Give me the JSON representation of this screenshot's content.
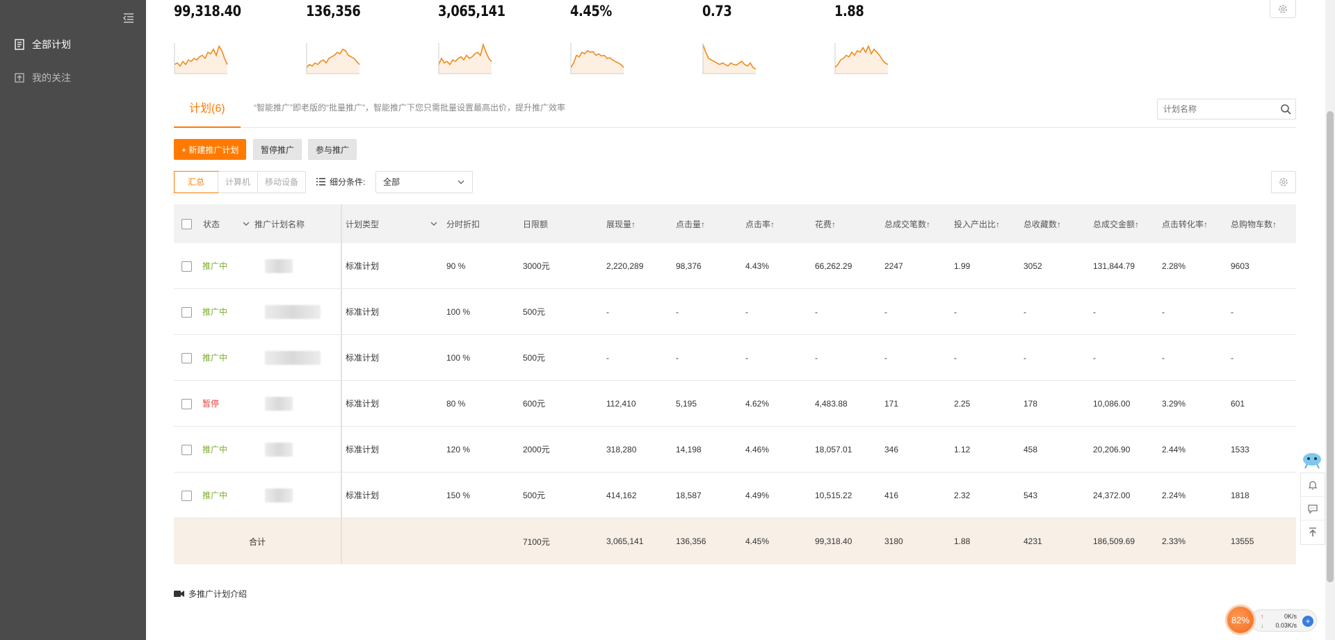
{
  "sidebar": {
    "items": [
      {
        "label": "全部计划",
        "icon": "document-icon",
        "active": true
      },
      {
        "label": "我的关注",
        "icon": "upload-box-icon",
        "active": false
      }
    ]
  },
  "metrics": [
    {
      "value": "99,318.40",
      "spark": [
        0.3,
        0.35,
        0.25,
        0.4,
        0.3,
        0.45,
        0.4,
        0.5,
        0.45,
        0.55,
        0.6,
        0.5,
        0.7,
        0.65,
        0.8,
        0.6,
        0.9,
        0.75,
        0.5,
        0.3
      ]
    },
    {
      "value": "136,356",
      "spark": [
        0.2,
        0.3,
        0.25,
        0.35,
        0.3,
        0.4,
        0.45,
        0.35,
        0.5,
        0.55,
        0.6,
        0.7,
        0.65,
        0.8,
        0.75,
        0.6,
        0.55,
        0.5,
        0.4,
        0.3
      ]
    },
    {
      "value": "3,065,141",
      "spark": [
        0.3,
        0.5,
        0.35,
        0.4,
        0.3,
        0.45,
        0.4,
        0.5,
        0.55,
        0.45,
        0.6,
        0.5,
        0.55,
        0.65,
        0.7,
        0.6,
        0.95,
        0.7,
        0.5,
        0.4
      ]
    },
    {
      "value": "4.45%",
      "spark": [
        0.2,
        0.35,
        0.6,
        0.55,
        0.7,
        0.65,
        0.75,
        0.7,
        0.72,
        0.6,
        0.65,
        0.58,
        0.6,
        0.5,
        0.52,
        0.45,
        0.4,
        0.35,
        0.3,
        0.2
      ]
    },
    {
      "value": "0.73",
      "spark": [
        0.95,
        0.7,
        0.5,
        0.45,
        0.4,
        0.35,
        0.3,
        0.35,
        0.3,
        0.25,
        0.35,
        0.3,
        0.28,
        0.35,
        0.4,
        0.3,
        0.25,
        0.35,
        0.2,
        0.15
      ]
    },
    {
      "value": "1.88",
      "spark": [
        0.2,
        0.3,
        0.45,
        0.5,
        0.6,
        0.55,
        0.7,
        0.6,
        0.75,
        0.7,
        0.85,
        0.7,
        0.9,
        0.65,
        0.8,
        0.7,
        0.6,
        0.45,
        0.35,
        0.3
      ]
    }
  ],
  "tabs": {
    "active_label": "计划(6)",
    "description": "“智能推广”即老版的“批量推广”，智能推广下您只需批量设置最高出价，提升推广效率",
    "search_placeholder": "计划名称"
  },
  "actions": {
    "new_plan": "+ 新建推广计划",
    "pause": "暂停推广",
    "join": "参与推广"
  },
  "device_tabs": [
    "汇总",
    "计算机",
    "移动设备"
  ],
  "filter": {
    "label": "细分条件:",
    "selected": "全部"
  },
  "table": {
    "headers": {
      "status": "状态",
      "name": "推广计划名称",
      "type": "计划类型",
      "discount": "分时折扣",
      "budget": "日限额",
      "impressions": "展现量↑",
      "clicks": "点击量↑",
      "ctr": "点击率↑",
      "cost": "花费↑",
      "orders": "总成交笔数↑",
      "roi": "投入产出比↑",
      "favorites": "总收藏数↑",
      "gmv": "总成交金额↑",
      "cvr": "点击转化率↑",
      "cart": "总购物车数↑"
    },
    "rows": [
      {
        "status": "推广中",
        "status_kind": "on",
        "type": "标准计划",
        "discount": "90 %",
        "budget": "3000元",
        "impressions": "2,220,289",
        "clicks": "98,376",
        "ctr": "4.43%",
        "cost": "66,262.29",
        "orders": "2247",
        "roi": "1.99",
        "favorites": "3052",
        "gmv": "131,844.79",
        "cvr": "2.28%",
        "cart": "9603"
      },
      {
        "status": "推广中",
        "status_kind": "on",
        "type": "标准计划",
        "discount": "100 %",
        "budget": "500元",
        "impressions": "-",
        "clicks": "-",
        "ctr": "-",
        "cost": "-",
        "orders": "-",
        "roi": "-",
        "favorites": "-",
        "gmv": "-",
        "cvr": "-",
        "cart": "-"
      },
      {
        "status": "推广中",
        "status_kind": "on",
        "type": "标准计划",
        "discount": "100 %",
        "budget": "500元",
        "impressions": "-",
        "clicks": "-",
        "ctr": "-",
        "cost": "-",
        "orders": "-",
        "roi": "-",
        "favorites": "-",
        "gmv": "-",
        "cvr": "-",
        "cart": "-"
      },
      {
        "status": "暂停",
        "status_kind": "off",
        "type": "标准计划",
        "discount": "80 %",
        "budget": "600元",
        "impressions": "112,410",
        "clicks": "5,195",
        "ctr": "4.62%",
        "cost": "4,483.88",
        "orders": "171",
        "roi": "2.25",
        "favorites": "178",
        "gmv": "10,086.00",
        "cvr": "3.29%",
        "cart": "601"
      },
      {
        "status": "推广中",
        "status_kind": "on",
        "type": "标准计划",
        "discount": "120 %",
        "budget": "2000元",
        "impressions": "318,280",
        "clicks": "14,198",
        "ctr": "4.46%",
        "cost": "18,057.01",
        "orders": "346",
        "roi": "1.12",
        "favorites": "458",
        "gmv": "20,206.90",
        "cvr": "2.44%",
        "cart": "1533"
      },
      {
        "status": "推广中",
        "status_kind": "on",
        "type": "标准计划",
        "discount": "150 %",
        "budget": "500元",
        "impressions": "414,162",
        "clicks": "18,587",
        "ctr": "4.49%",
        "cost": "10,515.22",
        "orders": "416",
        "roi": "2.32",
        "favorites": "543",
        "gmv": "24,372.00",
        "cvr": "2.24%",
        "cart": "1818"
      }
    ],
    "total": {
      "label": "合计",
      "budget": "7100元",
      "impressions": "3,065,141",
      "clicks": "136,356",
      "ctr": "4.45%",
      "cost": "99,318.40",
      "orders": "3180",
      "roi": "1.88",
      "favorites": "4231",
      "gmv": "186,509.69",
      "cvr": "2.33%",
      "cart": "13555"
    }
  },
  "footer_link": "多推广计划介绍",
  "net_widget": {
    "percent": "82%",
    "up": "0K/s",
    "down": "0.03K/s"
  },
  "colors": {
    "accent": "#ff7a00",
    "sidebar": "#4b4b4b",
    "status_on": "#7cad2b",
    "status_off": "#e8443a",
    "spark": "#f08a1c"
  }
}
